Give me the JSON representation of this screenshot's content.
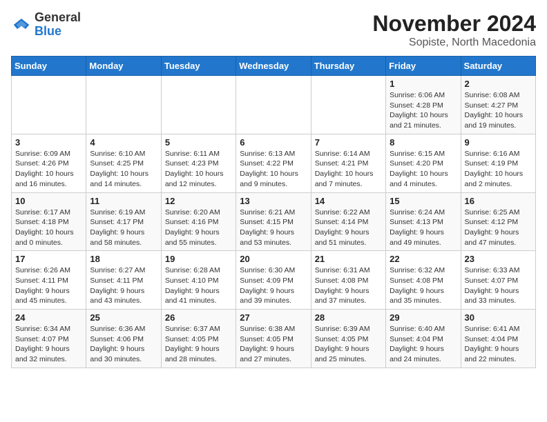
{
  "logo": {
    "general": "General",
    "blue": "Blue"
  },
  "title": "November 2024",
  "location": "Sopiste, North Macedonia",
  "days_header": [
    "Sunday",
    "Monday",
    "Tuesday",
    "Wednesday",
    "Thursday",
    "Friday",
    "Saturday"
  ],
  "weeks": [
    [
      {
        "day": "",
        "info": ""
      },
      {
        "day": "",
        "info": ""
      },
      {
        "day": "",
        "info": ""
      },
      {
        "day": "",
        "info": ""
      },
      {
        "day": "",
        "info": ""
      },
      {
        "day": "1",
        "info": "Sunrise: 6:06 AM\nSunset: 4:28 PM\nDaylight: 10 hours\nand 21 minutes."
      },
      {
        "day": "2",
        "info": "Sunrise: 6:08 AM\nSunset: 4:27 PM\nDaylight: 10 hours\nand 19 minutes."
      }
    ],
    [
      {
        "day": "3",
        "info": "Sunrise: 6:09 AM\nSunset: 4:26 PM\nDaylight: 10 hours\nand 16 minutes."
      },
      {
        "day": "4",
        "info": "Sunrise: 6:10 AM\nSunset: 4:25 PM\nDaylight: 10 hours\nand 14 minutes."
      },
      {
        "day": "5",
        "info": "Sunrise: 6:11 AM\nSunset: 4:23 PM\nDaylight: 10 hours\nand 12 minutes."
      },
      {
        "day": "6",
        "info": "Sunrise: 6:13 AM\nSunset: 4:22 PM\nDaylight: 10 hours\nand 9 minutes."
      },
      {
        "day": "7",
        "info": "Sunrise: 6:14 AM\nSunset: 4:21 PM\nDaylight: 10 hours\nand 7 minutes."
      },
      {
        "day": "8",
        "info": "Sunrise: 6:15 AM\nSunset: 4:20 PM\nDaylight: 10 hours\nand 4 minutes."
      },
      {
        "day": "9",
        "info": "Sunrise: 6:16 AM\nSunset: 4:19 PM\nDaylight: 10 hours\nand 2 minutes."
      }
    ],
    [
      {
        "day": "10",
        "info": "Sunrise: 6:17 AM\nSunset: 4:18 PM\nDaylight: 10 hours\nand 0 minutes."
      },
      {
        "day": "11",
        "info": "Sunrise: 6:19 AM\nSunset: 4:17 PM\nDaylight: 9 hours\nand 58 minutes."
      },
      {
        "day": "12",
        "info": "Sunrise: 6:20 AM\nSunset: 4:16 PM\nDaylight: 9 hours\nand 55 minutes."
      },
      {
        "day": "13",
        "info": "Sunrise: 6:21 AM\nSunset: 4:15 PM\nDaylight: 9 hours\nand 53 minutes."
      },
      {
        "day": "14",
        "info": "Sunrise: 6:22 AM\nSunset: 4:14 PM\nDaylight: 9 hours\nand 51 minutes."
      },
      {
        "day": "15",
        "info": "Sunrise: 6:24 AM\nSunset: 4:13 PM\nDaylight: 9 hours\nand 49 minutes."
      },
      {
        "day": "16",
        "info": "Sunrise: 6:25 AM\nSunset: 4:12 PM\nDaylight: 9 hours\nand 47 minutes."
      }
    ],
    [
      {
        "day": "17",
        "info": "Sunrise: 6:26 AM\nSunset: 4:11 PM\nDaylight: 9 hours\nand 45 minutes."
      },
      {
        "day": "18",
        "info": "Sunrise: 6:27 AM\nSunset: 4:11 PM\nDaylight: 9 hours\nand 43 minutes."
      },
      {
        "day": "19",
        "info": "Sunrise: 6:28 AM\nSunset: 4:10 PM\nDaylight: 9 hours\nand 41 minutes."
      },
      {
        "day": "20",
        "info": "Sunrise: 6:30 AM\nSunset: 4:09 PM\nDaylight: 9 hours\nand 39 minutes."
      },
      {
        "day": "21",
        "info": "Sunrise: 6:31 AM\nSunset: 4:08 PM\nDaylight: 9 hours\nand 37 minutes."
      },
      {
        "day": "22",
        "info": "Sunrise: 6:32 AM\nSunset: 4:08 PM\nDaylight: 9 hours\nand 35 minutes."
      },
      {
        "day": "23",
        "info": "Sunrise: 6:33 AM\nSunset: 4:07 PM\nDaylight: 9 hours\nand 33 minutes."
      }
    ],
    [
      {
        "day": "24",
        "info": "Sunrise: 6:34 AM\nSunset: 4:07 PM\nDaylight: 9 hours\nand 32 minutes."
      },
      {
        "day": "25",
        "info": "Sunrise: 6:36 AM\nSunset: 4:06 PM\nDaylight: 9 hours\nand 30 minutes."
      },
      {
        "day": "26",
        "info": "Sunrise: 6:37 AM\nSunset: 4:05 PM\nDaylight: 9 hours\nand 28 minutes."
      },
      {
        "day": "27",
        "info": "Sunrise: 6:38 AM\nSunset: 4:05 PM\nDaylight: 9 hours\nand 27 minutes."
      },
      {
        "day": "28",
        "info": "Sunrise: 6:39 AM\nSunset: 4:05 PM\nDaylight: 9 hours\nand 25 minutes."
      },
      {
        "day": "29",
        "info": "Sunrise: 6:40 AM\nSunset: 4:04 PM\nDaylight: 9 hours\nand 24 minutes."
      },
      {
        "day": "30",
        "info": "Sunrise: 6:41 AM\nSunset: 4:04 PM\nDaylight: 9 hours\nand 22 minutes."
      }
    ]
  ]
}
